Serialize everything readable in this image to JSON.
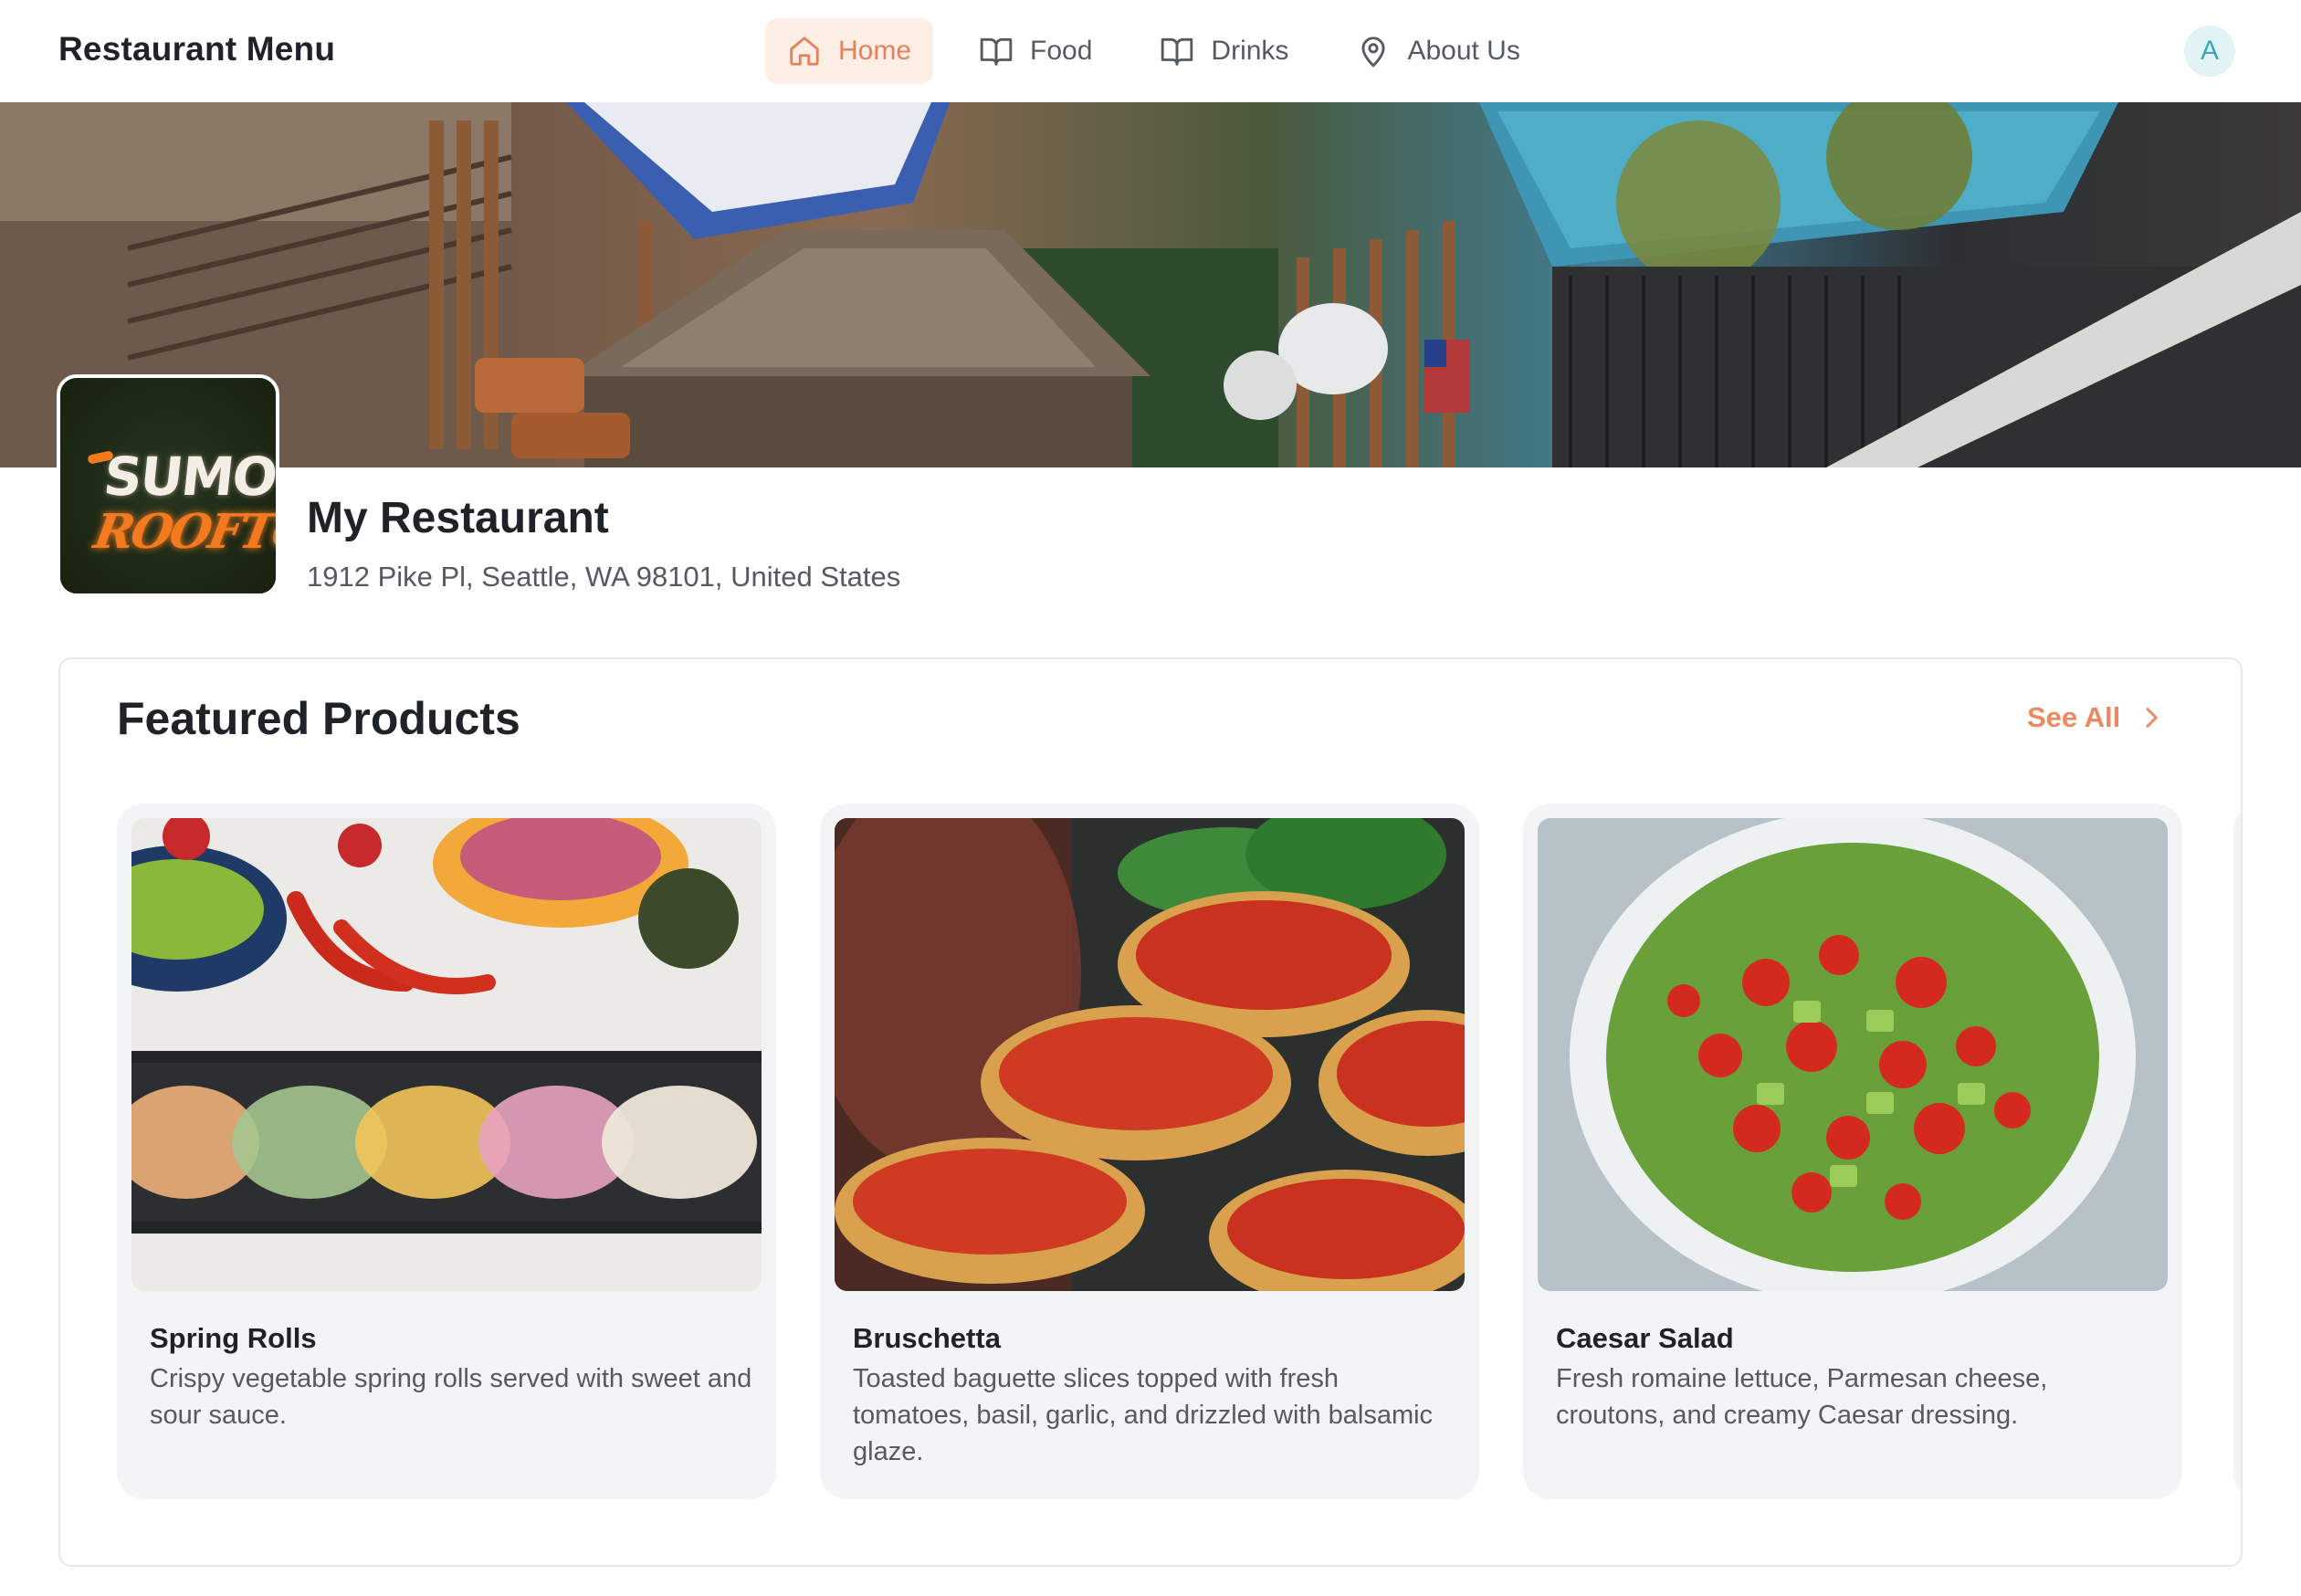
{
  "app": {
    "title": "Restaurant Menu"
  },
  "nav": {
    "items": [
      {
        "label": "Home",
        "icon": "home-icon",
        "active": true
      },
      {
        "label": "Food",
        "icon": "book-open-icon",
        "active": false
      },
      {
        "label": "Drinks",
        "icon": "book-open-icon",
        "active": false
      },
      {
        "label": "About Us",
        "icon": "map-pin-icon",
        "active": false
      }
    ]
  },
  "user": {
    "avatar_initial": "A"
  },
  "restaurant": {
    "name": "My Restaurant",
    "address": "1912 Pike Pl, Seattle, WA 98101, United States",
    "logo": {
      "line1": "SUMO",
      "line2": "ROOFTOP"
    }
  },
  "featured": {
    "title": "Featured Products",
    "see_all_label": "See All",
    "products": [
      {
        "name": "Spring Rolls",
        "description": "Crispy vegetable spring rolls served with sweet and sour sauce."
      },
      {
        "name": "Bruschetta",
        "description": "Toasted baguette slices topped with fresh tomatoes, basil, garlic, and drizzled with balsamic glaze."
      },
      {
        "name": "Caesar Salad",
        "description": "Fresh romaine lettuce, Parmesan cheese, croutons, and creamy Caesar dressing."
      }
    ]
  },
  "colors": {
    "accent": "#ea8a62",
    "active_nav_bg": "#fdeee6",
    "card_bg": "#f3f4f6",
    "avatar_bg": "#e2f3f5"
  }
}
